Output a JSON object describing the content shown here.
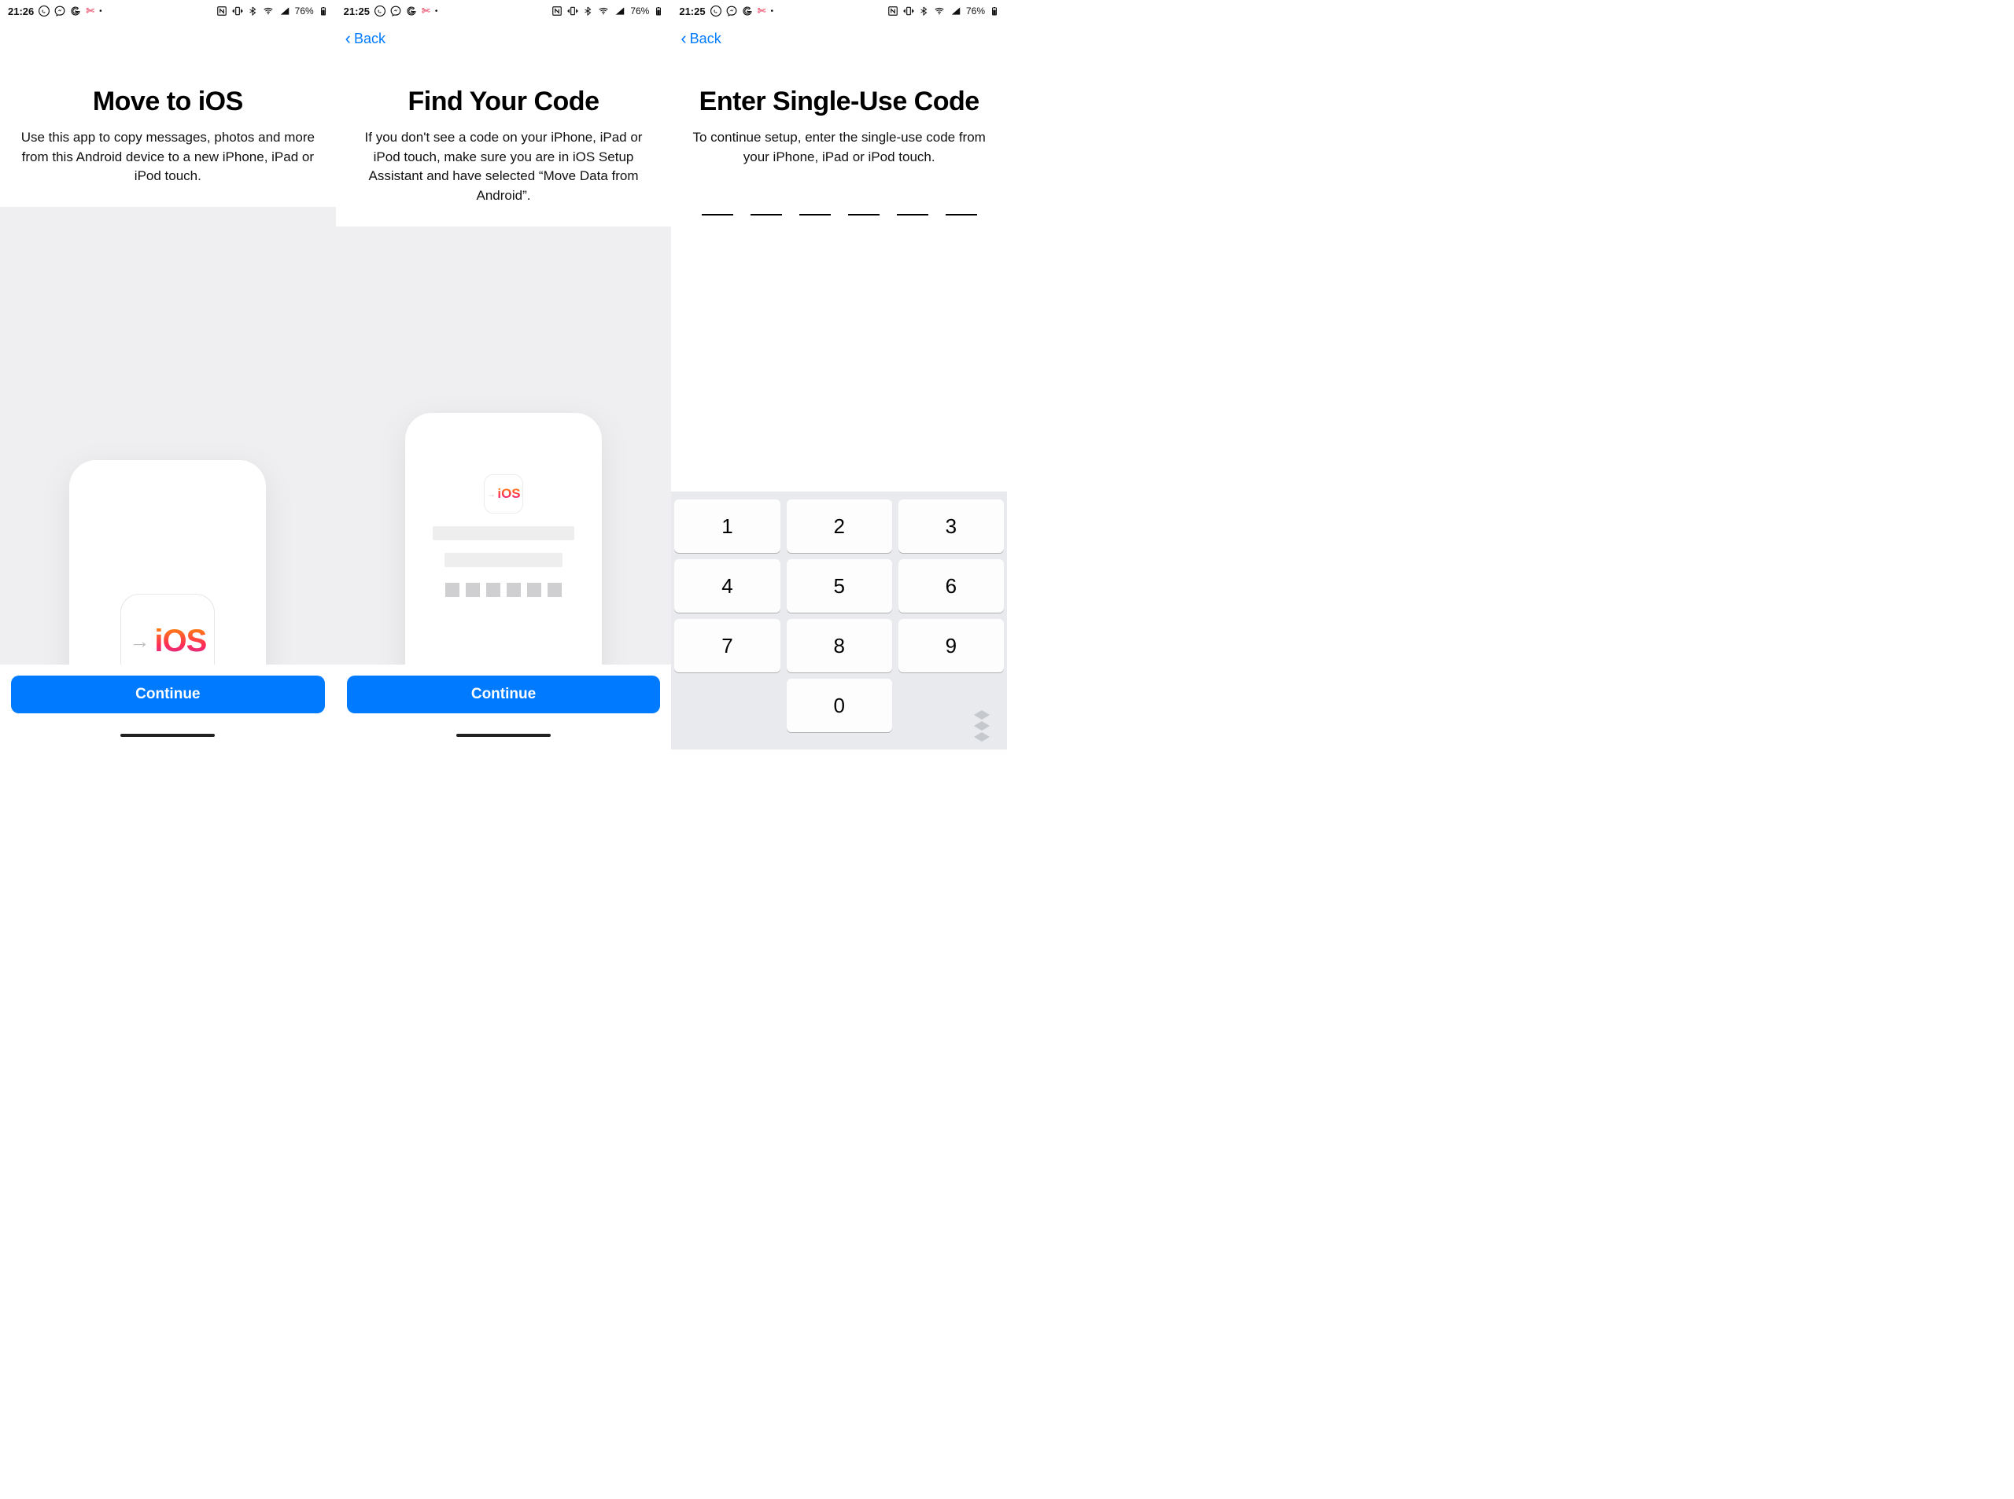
{
  "screens": [
    {
      "statusbar": {
        "time": "21:26",
        "battery_pct": "76%"
      },
      "back_label": null,
      "title": "Move to iOS",
      "subtitle": "Use this app to copy messages, photos and more from this Android device to a new iPhone, iPad or iPod touch.",
      "ios_label": "iOS",
      "continue_label": "Continue"
    },
    {
      "statusbar": {
        "time": "21:25",
        "battery_pct": "76%"
      },
      "back_label": "Back",
      "title": "Find Your Code",
      "subtitle": "If you don't see a code on your iPhone, iPad or iPod touch, make sure you are in iOS Setup Assistant and have selected “Move Data from Android”.",
      "ios_label": "iOS",
      "continue_label": "Continue"
    },
    {
      "statusbar": {
        "time": "21:25",
        "battery_pct": "76%"
      },
      "back_label": "Back",
      "title": "Enter Single-Use Code",
      "subtitle": "To continue setup, enter the single-use code from your iPhone, iPad or iPod touch.",
      "code_length": 6,
      "keypad": {
        "rows": [
          [
            "1",
            "2",
            "3"
          ],
          [
            "4",
            "5",
            "6"
          ],
          [
            "7",
            "8",
            "9"
          ],
          [
            "",
            "0",
            ""
          ]
        ]
      }
    }
  ],
  "status_icons": [
    "whatsapp",
    "messenger",
    "google",
    "scissors",
    "more-dot",
    "nfc",
    "vibrate",
    "bluetooth",
    "wifi",
    "signal",
    "battery"
  ]
}
